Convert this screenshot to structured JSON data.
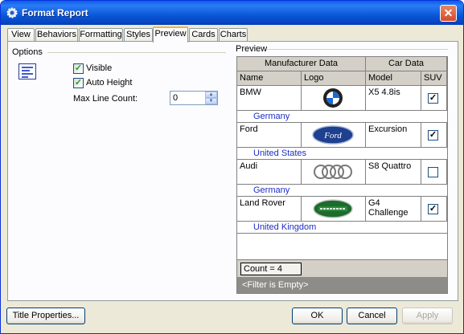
{
  "window": {
    "title": "Format Report"
  },
  "tabs": [
    "View",
    "Behaviors",
    "Formatting",
    "Styles",
    "Preview",
    "Cards",
    "Charts"
  ],
  "active_tab": "Preview",
  "options": {
    "group_label": "Options",
    "visible_label": "Visible",
    "visible_checked": true,
    "auto_height_label": "Auto Height",
    "auto_height_checked": true,
    "max_line_count_label": "Max Line Count:",
    "max_line_count_value": "0"
  },
  "preview": {
    "group_label": "Preview",
    "band_headers": [
      "Manufacturer Data",
      "Car Data"
    ],
    "columns": [
      "Name",
      "Logo",
      "Model",
      "SUV"
    ],
    "rows": [
      {
        "name": "BMW",
        "logo": "bmw-logo",
        "model": "X5 4.8is",
        "suv": true,
        "country": "Germany"
      },
      {
        "name": "Ford",
        "logo": "ford-logo",
        "model": "Excursion",
        "suv": true,
        "country": "United States"
      },
      {
        "name": "Audi",
        "logo": "audi-logo",
        "model": "S8 Quattro",
        "suv": false,
        "country": "Germany"
      },
      {
        "name": "Land Rover",
        "logo": "land-rover-logo",
        "model": "G4 Challenge",
        "suv": true,
        "country": "United Kingdom"
      }
    ],
    "count_text": "Count = 4",
    "filter_text": "<Filter is Empty>"
  },
  "buttons": {
    "title_properties": "Title Properties...",
    "ok": "OK",
    "cancel": "Cancel",
    "apply": "Apply"
  },
  "colors": {
    "title_bar": "#0a5ee8",
    "country_text": "#1a2ec8",
    "active_tab_accent": "#f3b33c"
  }
}
